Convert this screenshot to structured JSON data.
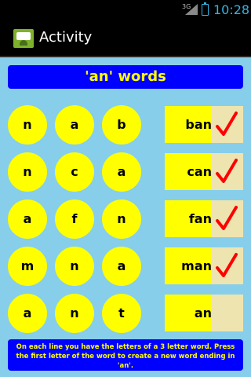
{
  "status_bar": {
    "network": "3G",
    "time": "10:28"
  },
  "action_bar": {
    "title": "Activity",
    "icon": "android-app-icon"
  },
  "header": {
    "title": "'an' words"
  },
  "rows": [
    {
      "letters": [
        "n",
        "a",
        "b"
      ],
      "word": "ban",
      "checked": true
    },
    {
      "letters": [
        "n",
        "c",
        "a"
      ],
      "word": "can",
      "checked": true
    },
    {
      "letters": [
        "a",
        "f",
        "n"
      ],
      "word": "fan",
      "checked": true
    },
    {
      "letters": [
        "m",
        "n",
        "a"
      ],
      "word": "man",
      "checked": true
    },
    {
      "letters": [
        "a",
        "n",
        "t"
      ],
      "word": "an",
      "checked": false
    }
  ],
  "instructions": "On each line you have the letters of a 3 letter word. Press the first letter of the word to create a new word  ending in 'an'.",
  "colors": {
    "background": "#87ceeb",
    "circle": "#ffff00",
    "banner": "#0000ff",
    "check": "#ff0000"
  }
}
